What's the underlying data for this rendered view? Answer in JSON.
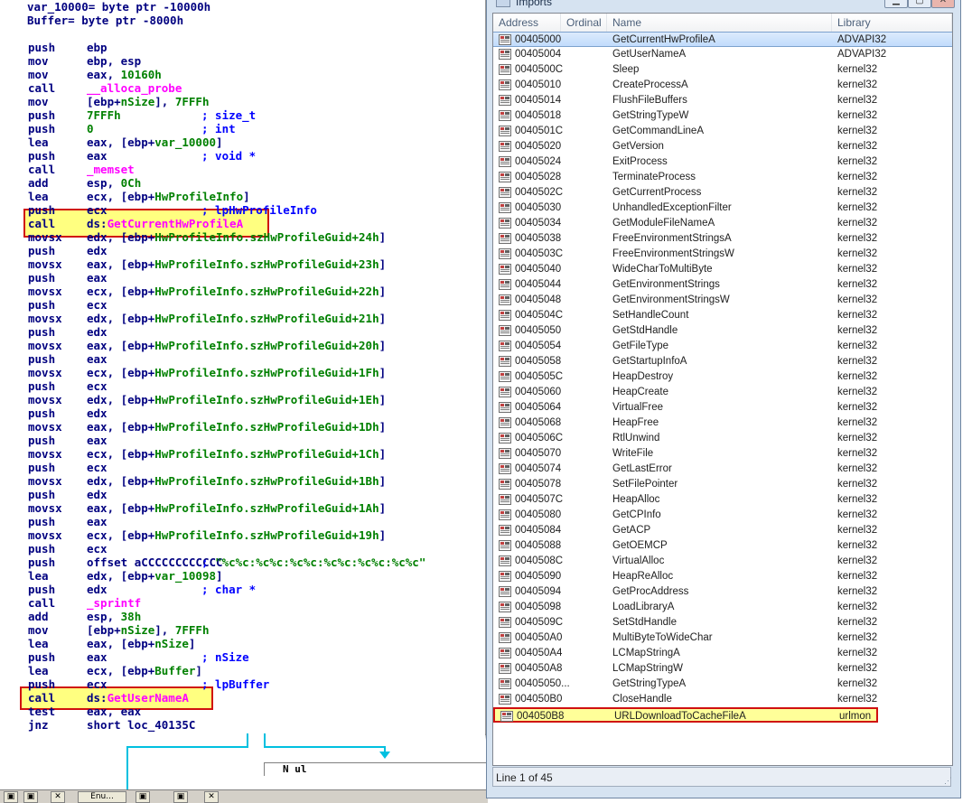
{
  "disasm": {
    "header": [
      "var_10000= byte ptr -10000h",
      "Buffer= byte ptr -8000h"
    ],
    "lines": [
      {
        "mn": "push",
        "op": [
          {
            "t": "ebp"
          }
        ]
      },
      {
        "mn": "mov",
        "op": [
          {
            "t": "ebp, esp"
          }
        ]
      },
      {
        "mn": "mov",
        "op": [
          {
            "t": "eax, "
          },
          {
            "t": "10160h",
            "c": "num"
          }
        ]
      },
      {
        "mn": "call",
        "op": [
          {
            "t": "__alloca_probe",
            "c": "fn"
          }
        ]
      },
      {
        "mn": "mov",
        "op": [
          {
            "t": "[ebp+"
          },
          {
            "t": "nSize",
            "c": "name"
          },
          {
            "t": "], "
          },
          {
            "t": "7FFFh",
            "c": "num"
          }
        ]
      },
      {
        "mn": "push",
        "op": [
          {
            "t": "7FFFh",
            "c": "num"
          }
        ],
        "cm": "; size_t"
      },
      {
        "mn": "push",
        "op": [
          {
            "t": "0",
            "c": "num"
          }
        ],
        "cm": "; int"
      },
      {
        "mn": "lea",
        "op": [
          {
            "t": "eax, [ebp+"
          },
          {
            "t": "var_10000",
            "c": "name"
          },
          {
            "t": "]"
          }
        ]
      },
      {
        "mn": "push",
        "op": [
          {
            "t": "eax"
          }
        ],
        "cm": "; void *"
      },
      {
        "mn": "call",
        "op": [
          {
            "t": "_memset",
            "c": "fn"
          }
        ]
      },
      {
        "mn": "add",
        "op": [
          {
            "t": "esp, "
          },
          {
            "t": "0Ch",
            "c": "num"
          }
        ]
      },
      {
        "mn": "lea",
        "op": [
          {
            "t": "ecx, [ebp+"
          },
          {
            "t": "HwProfileInfo",
            "c": "name"
          },
          {
            "t": "]"
          }
        ]
      },
      {
        "mn": "push",
        "op": [
          {
            "t": "ecx"
          }
        ],
        "cm": "; lpHwProfileInfo"
      },
      {
        "mn": "call",
        "op": [
          {
            "t": "ds:"
          },
          {
            "t": "GetCurrentHwProfileA",
            "c": "imp"
          }
        ],
        "hl": "a"
      },
      {
        "mn": "movsx",
        "op": [
          {
            "t": "edx, [ebp+"
          },
          {
            "t": "HwProfileInfo.szHwProfileGuid+24h",
            "c": "name"
          },
          {
            "t": "]"
          }
        ]
      },
      {
        "mn": "push",
        "op": [
          {
            "t": "edx"
          }
        ]
      },
      {
        "mn": "movsx",
        "op": [
          {
            "t": "eax, [ebp+"
          },
          {
            "t": "HwProfileInfo.szHwProfileGuid+23h",
            "c": "name"
          },
          {
            "t": "]"
          }
        ]
      },
      {
        "mn": "push",
        "op": [
          {
            "t": "eax"
          }
        ]
      },
      {
        "mn": "movsx",
        "op": [
          {
            "t": "ecx, [ebp+"
          },
          {
            "t": "HwProfileInfo.szHwProfileGuid+22h",
            "c": "name"
          },
          {
            "t": "]"
          }
        ]
      },
      {
        "mn": "push",
        "op": [
          {
            "t": "ecx"
          }
        ]
      },
      {
        "mn": "movsx",
        "op": [
          {
            "t": "edx, [ebp+"
          },
          {
            "t": "HwProfileInfo.szHwProfileGuid+21h",
            "c": "name"
          },
          {
            "t": "]"
          }
        ]
      },
      {
        "mn": "push",
        "op": [
          {
            "t": "edx"
          }
        ]
      },
      {
        "mn": "movsx",
        "op": [
          {
            "t": "eax, [ebp+"
          },
          {
            "t": "HwProfileInfo.szHwProfileGuid+20h",
            "c": "name"
          },
          {
            "t": "]"
          }
        ]
      },
      {
        "mn": "push",
        "op": [
          {
            "t": "eax"
          }
        ]
      },
      {
        "mn": "movsx",
        "op": [
          {
            "t": "ecx, [ebp+"
          },
          {
            "t": "HwProfileInfo.szHwProfileGuid+1Fh",
            "c": "name"
          },
          {
            "t": "]"
          }
        ]
      },
      {
        "mn": "push",
        "op": [
          {
            "t": "ecx"
          }
        ]
      },
      {
        "mn": "movsx",
        "op": [
          {
            "t": "edx, [ebp+"
          },
          {
            "t": "HwProfileInfo.szHwProfileGuid+1Eh",
            "c": "name"
          },
          {
            "t": "]"
          }
        ]
      },
      {
        "mn": "push",
        "op": [
          {
            "t": "edx"
          }
        ]
      },
      {
        "mn": "movsx",
        "op": [
          {
            "t": "eax, [ebp+"
          },
          {
            "t": "HwProfileInfo.szHwProfileGuid+1Dh",
            "c": "name"
          },
          {
            "t": "]"
          }
        ]
      },
      {
        "mn": "push",
        "op": [
          {
            "t": "eax"
          }
        ]
      },
      {
        "mn": "movsx",
        "op": [
          {
            "t": "ecx, [ebp+"
          },
          {
            "t": "HwProfileInfo.szHwProfileGuid+1Ch",
            "c": "name"
          },
          {
            "t": "]"
          }
        ]
      },
      {
        "mn": "push",
        "op": [
          {
            "t": "ecx"
          }
        ]
      },
      {
        "mn": "movsx",
        "op": [
          {
            "t": "edx, [ebp+"
          },
          {
            "t": "HwProfileInfo.szHwProfileGuid+1Bh",
            "c": "name"
          },
          {
            "t": "]"
          }
        ]
      },
      {
        "mn": "push",
        "op": [
          {
            "t": "edx"
          }
        ]
      },
      {
        "mn": "movsx",
        "op": [
          {
            "t": "eax, [ebp+"
          },
          {
            "t": "HwProfileInfo.szHwProfileGuid+1Ah",
            "c": "name"
          },
          {
            "t": "]"
          }
        ]
      },
      {
        "mn": "push",
        "op": [
          {
            "t": "eax"
          }
        ]
      },
      {
        "mn": "movsx",
        "op": [
          {
            "t": "ecx, [ebp+"
          },
          {
            "t": "HwProfileInfo.szHwProfileGuid+19h",
            "c": "name"
          },
          {
            "t": "]"
          }
        ]
      },
      {
        "mn": "push",
        "op": [
          {
            "t": "ecx"
          }
        ]
      },
      {
        "mn": "push",
        "op": [
          {
            "t": "offset "
          },
          {
            "t": "aCCCCCCCCCCCC",
            "c": "sym"
          }
        ],
        "cm": "; ",
        "cmstr": "\"%c%c:%c%c:%c%c:%c%c:%c%c:%c%c\""
      },
      {
        "mn": "lea",
        "op": [
          {
            "t": "edx, [ebp+"
          },
          {
            "t": "var_10098",
            "c": "name"
          },
          {
            "t": "]"
          }
        ]
      },
      {
        "mn": "push",
        "op": [
          {
            "t": "edx"
          }
        ],
        "cm": "; char *"
      },
      {
        "mn": "call",
        "op": [
          {
            "t": "_sprintf",
            "c": "fn"
          }
        ]
      },
      {
        "mn": "add",
        "op": [
          {
            "t": "esp, "
          },
          {
            "t": "38h",
            "c": "num"
          }
        ]
      },
      {
        "mn": "mov",
        "op": [
          {
            "t": "[ebp+"
          },
          {
            "t": "nSize",
            "c": "name"
          },
          {
            "t": "], "
          },
          {
            "t": "7FFFh",
            "c": "num"
          }
        ]
      },
      {
        "mn": "lea",
        "op": [
          {
            "t": "eax, [ebp+"
          },
          {
            "t": "nSize",
            "c": "name"
          },
          {
            "t": "]"
          }
        ]
      },
      {
        "mn": "push",
        "op": [
          {
            "t": "eax"
          }
        ],
        "cm": "; nSize"
      },
      {
        "mn": "lea",
        "op": [
          {
            "t": "ecx, [ebp+"
          },
          {
            "t": "Buffer",
            "c": "name"
          },
          {
            "t": "]"
          }
        ]
      },
      {
        "mn": "push",
        "op": [
          {
            "t": "ecx"
          }
        ],
        "cm": "; lpBuffer"
      },
      {
        "mn": "call",
        "op": [
          {
            "t": "ds:"
          },
          {
            "t": "GetUserNameA",
            "c": "imp"
          }
        ],
        "hl": "b"
      },
      {
        "mn": "test",
        "op": [
          {
            "t": "eax, eax"
          }
        ]
      },
      {
        "mn": "jnz",
        "op": [
          {
            "t": "short "
          },
          {
            "t": "loc_40135C",
            "c": "sym"
          }
        ]
      }
    ],
    "mini_node_label": "N ul"
  },
  "bottom_strip": [
    "▣",
    "▣",
    "✕",
    "Enu...",
    "▣",
    "▣",
    "✕"
  ],
  "imports": {
    "title": "Imports",
    "columns": [
      "Address",
      "Ordinal",
      "Name",
      "Library"
    ],
    "rows": [
      {
        "addr": "00405000",
        "name": "GetCurrentHwProfileA",
        "lib": "ADVAPI32",
        "state": "selected"
      },
      {
        "addr": "00405004",
        "name": "GetUserNameA",
        "lib": "ADVAPI32"
      },
      {
        "addr": "0040500C",
        "name": "Sleep",
        "lib": "kernel32"
      },
      {
        "addr": "00405010",
        "name": "CreateProcessA",
        "lib": "kernel32"
      },
      {
        "addr": "00405014",
        "name": "FlushFileBuffers",
        "lib": "kernel32"
      },
      {
        "addr": "00405018",
        "name": "GetStringTypeW",
        "lib": "kernel32"
      },
      {
        "addr": "0040501C",
        "name": "GetCommandLineA",
        "lib": "kernel32"
      },
      {
        "addr": "00405020",
        "name": "GetVersion",
        "lib": "kernel32"
      },
      {
        "addr": "00405024",
        "name": "ExitProcess",
        "lib": "kernel32"
      },
      {
        "addr": "00405028",
        "name": "TerminateProcess",
        "lib": "kernel32"
      },
      {
        "addr": "0040502C",
        "name": "GetCurrentProcess",
        "lib": "kernel32"
      },
      {
        "addr": "00405030",
        "name": "UnhandledExceptionFilter",
        "lib": "kernel32"
      },
      {
        "addr": "00405034",
        "name": "GetModuleFileNameA",
        "lib": "kernel32"
      },
      {
        "addr": "00405038",
        "name": "FreeEnvironmentStringsA",
        "lib": "kernel32"
      },
      {
        "addr": "0040503C",
        "name": "FreeEnvironmentStringsW",
        "lib": "kernel32"
      },
      {
        "addr": "00405040",
        "name": "WideCharToMultiByte",
        "lib": "kernel32"
      },
      {
        "addr": "00405044",
        "name": "GetEnvironmentStrings",
        "lib": "kernel32"
      },
      {
        "addr": "00405048",
        "name": "GetEnvironmentStringsW",
        "lib": "kernel32"
      },
      {
        "addr": "0040504C",
        "name": "SetHandleCount",
        "lib": "kernel32"
      },
      {
        "addr": "00405050",
        "name": "GetStdHandle",
        "lib": "kernel32"
      },
      {
        "addr": "00405054",
        "name": "GetFileType",
        "lib": "kernel32"
      },
      {
        "addr": "00405058",
        "name": "GetStartupInfoA",
        "lib": "kernel32"
      },
      {
        "addr": "0040505C",
        "name": "HeapDestroy",
        "lib": "kernel32"
      },
      {
        "addr": "00405060",
        "name": "HeapCreate",
        "lib": "kernel32"
      },
      {
        "addr": "00405064",
        "name": "VirtualFree",
        "lib": "kernel32"
      },
      {
        "addr": "00405068",
        "name": "HeapFree",
        "lib": "kernel32"
      },
      {
        "addr": "0040506C",
        "name": "RtlUnwind",
        "lib": "kernel32"
      },
      {
        "addr": "00405070",
        "name": "WriteFile",
        "lib": "kernel32"
      },
      {
        "addr": "00405074",
        "name": "GetLastError",
        "lib": "kernel32"
      },
      {
        "addr": "00405078",
        "name": "SetFilePointer",
        "lib": "kernel32"
      },
      {
        "addr": "0040507C",
        "name": "HeapAlloc",
        "lib": "kernel32"
      },
      {
        "addr": "00405080",
        "name": "GetCPInfo",
        "lib": "kernel32"
      },
      {
        "addr": "00405084",
        "name": "GetACP",
        "lib": "kernel32"
      },
      {
        "addr": "00405088",
        "name": "GetOEMCP",
        "lib": "kernel32"
      },
      {
        "addr": "0040508C",
        "name": "VirtualAlloc",
        "lib": "kernel32"
      },
      {
        "addr": "00405090",
        "name": "HeapReAlloc",
        "lib": "kernel32"
      },
      {
        "addr": "00405094",
        "name": "GetProcAddress",
        "lib": "kernel32"
      },
      {
        "addr": "00405098",
        "name": "LoadLibraryA",
        "lib": "kernel32"
      },
      {
        "addr": "0040509C",
        "name": "SetStdHandle",
        "lib": "kernel32"
      },
      {
        "addr": "004050A0",
        "name": "MultiByteToWideChar",
        "lib": "kernel32"
      },
      {
        "addr": "004050A4",
        "name": "LCMapStringA",
        "lib": "kernel32"
      },
      {
        "addr": "004050A8",
        "name": "LCMapStringW",
        "lib": "kernel32"
      },
      {
        "addr": "00405050...",
        "name": "GetStringTypeA",
        "lib": "kernel32"
      },
      {
        "addr": "004050B0",
        "name": "CloseHandle",
        "lib": "kernel32"
      },
      {
        "addr": "004050B8",
        "name": "URLDownloadToCacheFileA",
        "lib": "urlmon",
        "state": "flagged"
      }
    ],
    "status": "Line 1 of 45"
  }
}
